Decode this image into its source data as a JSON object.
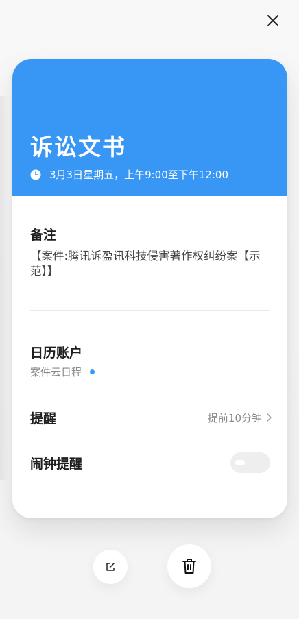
{
  "header": {
    "title": "诉讼文书",
    "time": "3月3日星期五，上午9:00至下午12:00",
    "color": "#3896f5"
  },
  "note": {
    "label": "备注",
    "text": "【案件:腾讯诉盈讯科技侵害著作权纠纷案【示范】】"
  },
  "calendar": {
    "label": "日历账户",
    "value": "案件云日程",
    "dot_color": "#3896f5"
  },
  "reminder": {
    "label": "提醒",
    "value": "提前10分钟"
  },
  "alarm": {
    "label": "闹钟提醒",
    "enabled": false
  },
  "icons": {
    "close": "close-icon",
    "clock": "clock-icon",
    "chevron": "chevron-right-icon",
    "edit": "edit-icon",
    "delete": "trash-icon"
  }
}
